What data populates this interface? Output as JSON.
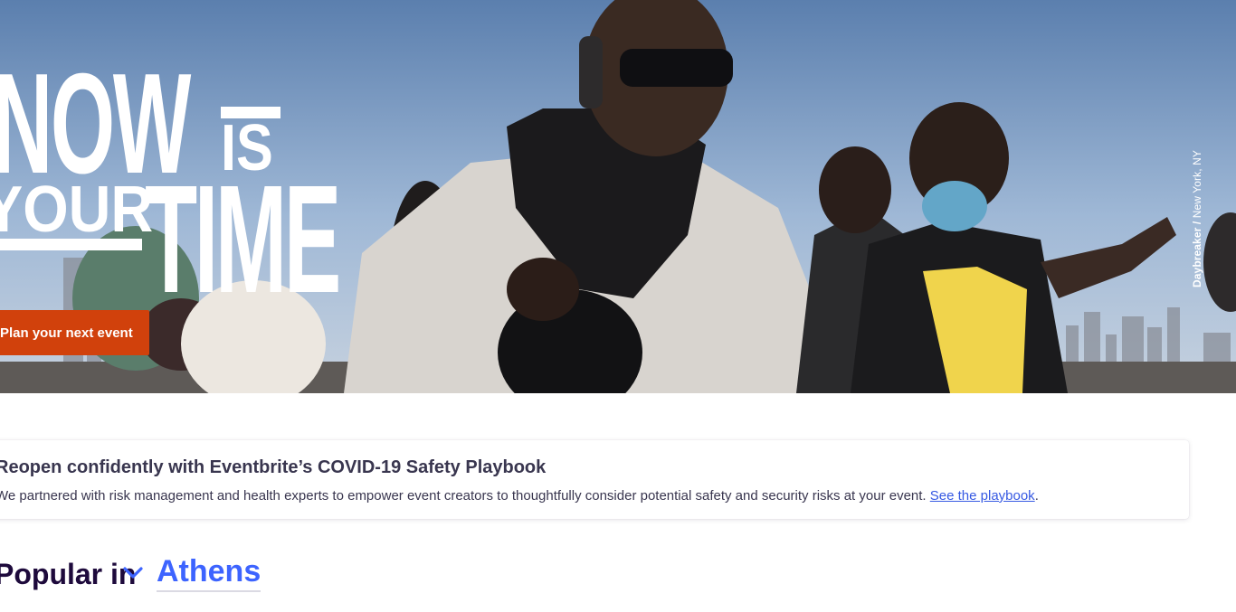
{
  "hero": {
    "headline": {
      "word1": "NOW",
      "word2": "IS",
      "word3": "YOUR",
      "word4": "TIME"
    },
    "cta_label": "Plan your next event",
    "photo_credit": {
      "name": "Daybreaker",
      "location": "New York, NY"
    }
  },
  "covid": {
    "title": "Reopen confidently with Eventbrite’s COVID-19 Safety Playbook",
    "description": "We partnered with risk management and health experts to empower event creators to thoughtfully consider potential safety and security risks at your event.",
    "link_text": "See the playbook"
  },
  "popular": {
    "label": "Popular in",
    "location": "Athens"
  },
  "colors": {
    "brand_orange": "#d1410c",
    "link_blue": "#3659e3",
    "location_blue": "#3d64ff",
    "text_dark": "#1e0a3c"
  },
  "icons": [
    "chevron-down-icon"
  ]
}
